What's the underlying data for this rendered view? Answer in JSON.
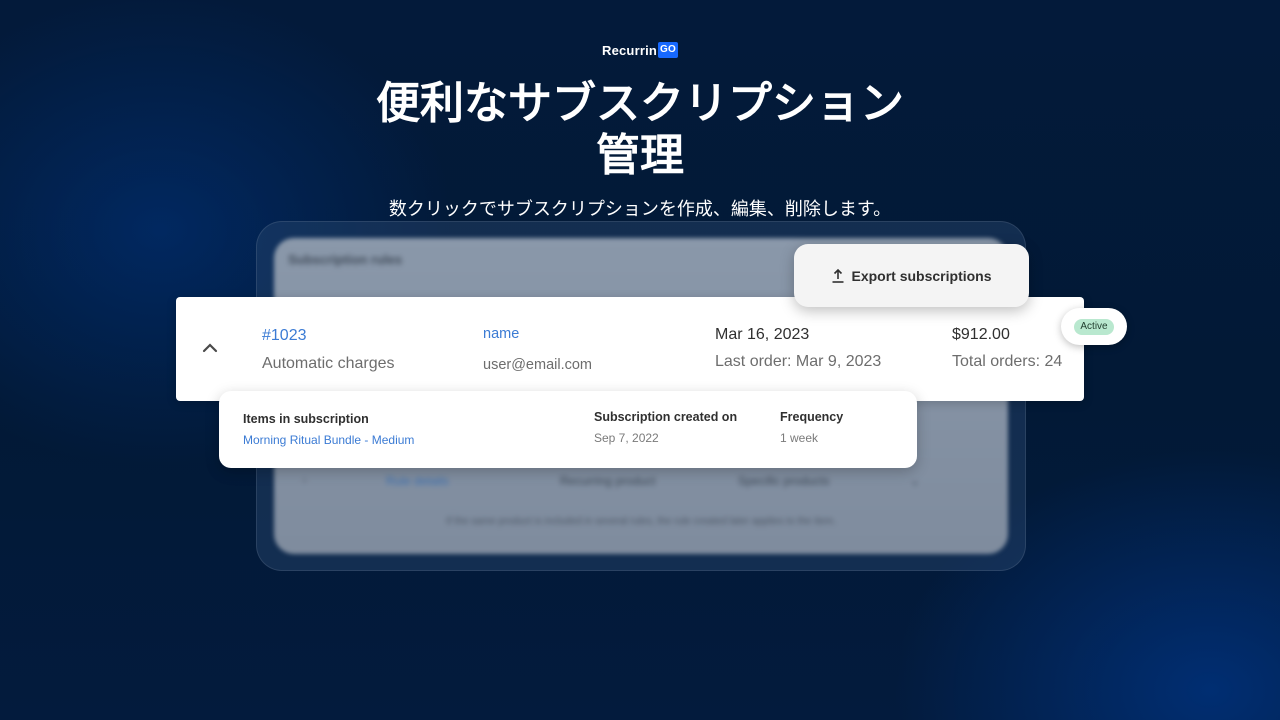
{
  "brand": {
    "name_prefix": "Recurrin",
    "name_suffix": "GO",
    "accent_color": "#1769ff"
  },
  "hero": {
    "title_line1": "便利なサブスクリプション",
    "title_line2": "管理",
    "subtitle": "数クリックでサブスクリプションを作成、編集、削除します。"
  },
  "background_panel": {
    "title": "Subscription rules",
    "row": {
      "link": "Rule details",
      "col2": "Recurring product",
      "col3": "Specific products"
    },
    "note": "If the same product is included in several rules, the rule created later applies to the item."
  },
  "export_button": {
    "icon": "upload-icon",
    "label": "Export subscriptions"
  },
  "subscription": {
    "expand_icon": "chevron-up-icon",
    "id": "#1023",
    "type": "Automatic charges",
    "customer_name": "name",
    "customer_email": "user@email.com",
    "next_date": "Mar 16, 2023",
    "last_order": "Last order: Mar 9, 2023",
    "amount": "$912.00",
    "total_orders": "Total orders: 24",
    "status": "Active",
    "status_color": "#b9e8cf"
  },
  "details": {
    "items_header": "Items in subscription",
    "item_name": "Morning Ritual Bundle - Medium",
    "created_header": "Subscription created on",
    "created_value": "Sep 7, 2022",
    "frequency_header": "Frequency",
    "frequency_value": "1 week"
  }
}
